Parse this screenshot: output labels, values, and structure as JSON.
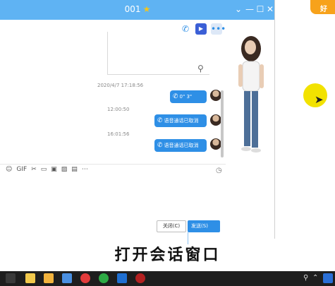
{
  "window": {
    "title": "001",
    "star": "★",
    "buttons": [
      "⌄",
      "—",
      "☐",
      "✕"
    ]
  },
  "chat": {
    "timestamps": [
      "2020/4/7 17:18:56",
      "12:00:50",
      "16:01:56"
    ],
    "messages": [
      {
        "text": "0\" 3\""
      },
      {
        "text": "语音通话已取消"
      },
      {
        "text": "语音通话已取消"
      }
    ]
  },
  "input_toolbar": [
    "☺",
    "GIF",
    "✂",
    "▭",
    "▣",
    "▨",
    "▤",
    "⋯"
  ],
  "footer": {
    "close_label": "关闭(C)",
    "send_label": "发送(S)",
    "dropdown": "⌄"
  },
  "caption": "打开会话窗口",
  "corner_logo": "好",
  "colors": {
    "titlebar": "#5fb3f3",
    "accent": "#2e8fe6",
    "taskbar": "#1e1e1e",
    "cursor_highlight": "#f2e200"
  },
  "icons": {
    "phone": "phone-icon",
    "video": "video-call-icon",
    "more": "more-icon"
  }
}
